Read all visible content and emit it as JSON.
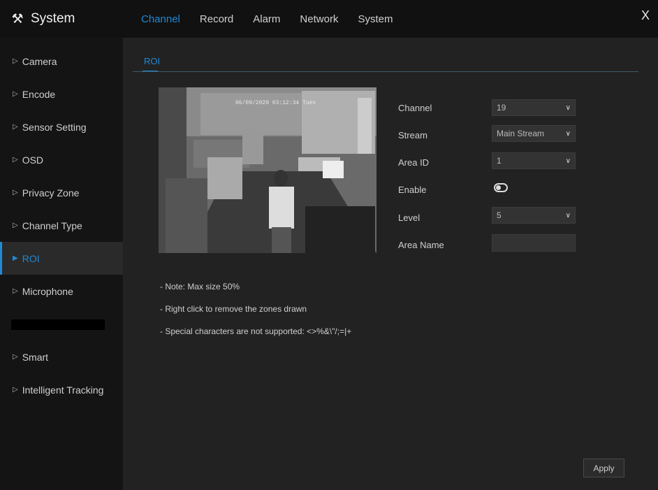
{
  "header": {
    "title": "System",
    "title_icon": "tools-icon",
    "tabs": [
      {
        "label": "Channel",
        "active": true
      },
      {
        "label": "Record",
        "active": false
      },
      {
        "label": "Alarm",
        "active": false
      },
      {
        "label": "Network",
        "active": false
      },
      {
        "label": "System",
        "active": false
      }
    ],
    "close_label": "X"
  },
  "sidebar": {
    "items": [
      {
        "label": "Camera",
        "active": false
      },
      {
        "label": "Encode",
        "active": false
      },
      {
        "label": "Sensor Setting",
        "active": false
      },
      {
        "label": "OSD",
        "active": false
      },
      {
        "label": "Privacy Zone",
        "active": false
      },
      {
        "label": "Channel Type",
        "active": false
      },
      {
        "label": "ROI",
        "active": true
      },
      {
        "label": "Microphone",
        "active": false
      },
      {
        "label": "",
        "active": false,
        "redacted": true
      },
      {
        "label": "Smart",
        "active": false
      },
      {
        "label": "Intelligent Tracking",
        "active": false
      }
    ]
  },
  "content": {
    "subtab": "ROI",
    "preview": {
      "timestamp": "06/09/2020 03:12:34 Tues"
    },
    "form": {
      "channel_label": "Channel",
      "channel_value": "19",
      "stream_label": "Stream",
      "stream_value": "Main Stream",
      "area_id_label": "Area ID",
      "area_id_value": "1",
      "enable_label": "Enable",
      "level_label": "Level",
      "level_value": "5",
      "area_name_label": "Area Name",
      "area_name_value": ""
    },
    "notes": [
      "- Note: Max size 50%",
      "- Right click to remove the zones drawn",
      "- Special characters are not supported: <>%&\\\"/;=|+"
    ],
    "apply_label": "Apply"
  },
  "colors": {
    "accent": "#1f8ad6",
    "background": "#222222",
    "sidebar": "#141414",
    "topbar": "#111111"
  }
}
